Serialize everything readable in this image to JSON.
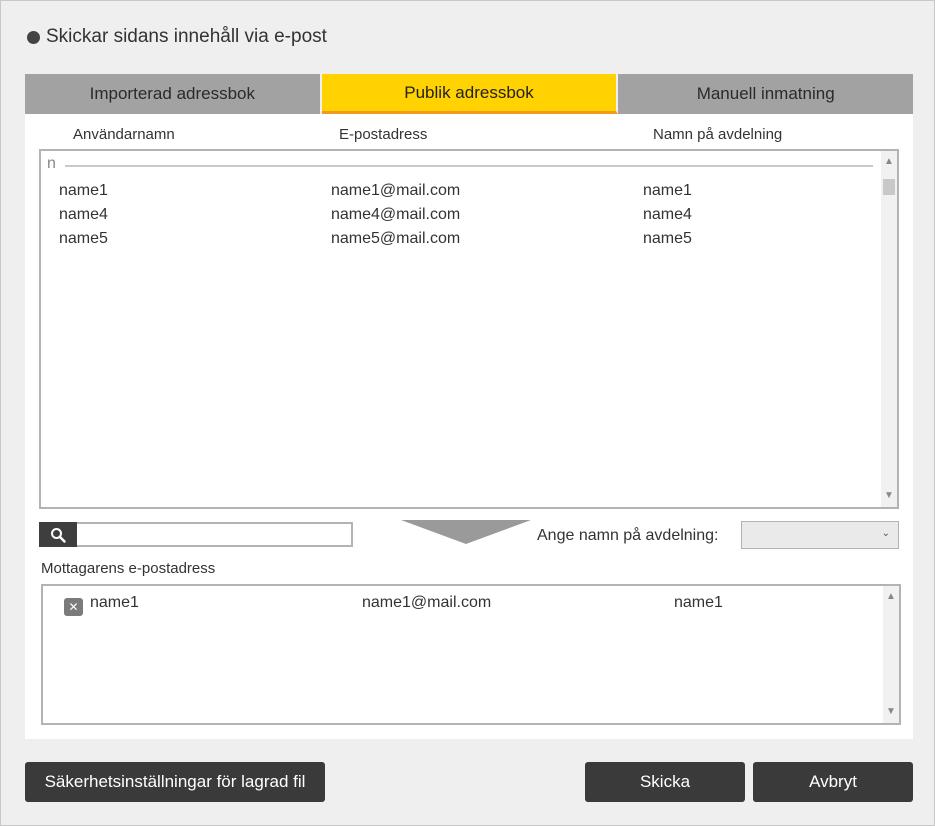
{
  "dialog": {
    "title": "Skickar sidans innehåll via e-post"
  },
  "tabs": [
    {
      "label": "Importerad adressbok",
      "active": false
    },
    {
      "label": "Publik adressbok",
      "active": true
    },
    {
      "label": "Manuell inmatning",
      "active": false
    }
  ],
  "columns": {
    "username": "Användarnamn",
    "email": "E-postadress",
    "department": "Namn på avdelning"
  },
  "address_list": {
    "group_label": "n",
    "rows": [
      {
        "name": "name1",
        "email": "name1@mail.com",
        "department": "name1"
      },
      {
        "name": "name4",
        "email": "name4@mail.com",
        "department": "name4"
      },
      {
        "name": "name5",
        "email": "name5@mail.com",
        "department": "name5"
      }
    ]
  },
  "search": {
    "icon": "search-icon",
    "value": "",
    "placeholder": ""
  },
  "department": {
    "label": "Ange namn på avdelning:",
    "selected": ""
  },
  "recipients": {
    "label": "Mottagarens e-postadress",
    "rows": [
      {
        "name": "name1",
        "email": "name1@mail.com",
        "department": "name1"
      }
    ]
  },
  "footer": {
    "security_label": "Säkerhetsinställningar för lagrad fil",
    "send_label": "Skicka",
    "cancel_label": "Avbryt"
  },
  "colors": {
    "active_tab": "#ffd200",
    "active_tab_underline": "#f39a1e",
    "inactive_tab": "#a2a2a2",
    "button": "#3a3a3a"
  }
}
